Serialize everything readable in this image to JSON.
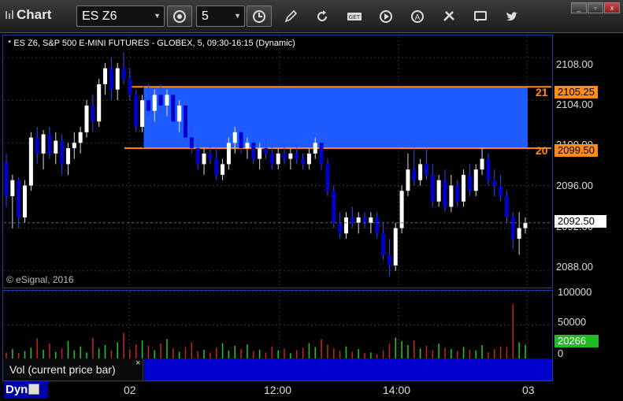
{
  "toolbar": {
    "title": "Chart",
    "symbol": "ES Z6",
    "interval": "5",
    "icons": [
      "settings-icon",
      "clock-icon",
      "pencil-icon",
      "refresh-icon",
      "get-icon",
      "play-icon",
      "alert-icon",
      "tools-icon",
      "comment-icon",
      "twitter-icon"
    ]
  },
  "window": {
    "controls": [
      "minimize",
      "restore",
      "close"
    ]
  },
  "chart": {
    "title": "* ES Z6, S&P 500 E-MINI FUTURES - GLOBEX, 5, 09:30-16:15 (Dynamic)",
    "watermark": "© eSignal, 2016",
    "price_labels": [
      "2108.00",
      "2104.00",
      "2100.00",
      "2096.00",
      "2092.00",
      "2088.00"
    ],
    "zone_top_tag": "2105.25",
    "zone_bottom_tag": "2099.50",
    "zone_top_label": "21",
    "zone_bottom_label": "20",
    "last_price_tag": "2092.50",
    "colors": {
      "zone": "#1e5cff",
      "zone_line": "#ff8c1a",
      "up": "#ffffff",
      "down": "#0000cc",
      "background": "#000000"
    }
  },
  "volume": {
    "legend": "Vol (current price bar)",
    "close_glyph": "×",
    "labels": [
      "100000",
      "50000",
      "0"
    ],
    "current_tag": "20266"
  },
  "time_axis": {
    "labels": [
      "02",
      "12:00",
      "14:00",
      "03"
    ],
    "mode": "Dyn"
  },
  "chart_data": {
    "type": "candlestick",
    "ylim": [
      2086.5,
      2110.0
    ],
    "zone": {
      "low": 2099.5,
      "high": 2105.25
    },
    "last_price": 2092.5,
    "ohlc": [
      [
        2098.2,
        2099.0,
        2094.0,
        2095.0
      ],
      [
        2095.0,
        2097.0,
        2092.0,
        2096.5
      ],
      [
        2096.5,
        2096.8,
        2092.0,
        2093.0
      ],
      [
        2093.0,
        2096.5,
        2092.5,
        2096.0
      ],
      [
        2096.0,
        2101.0,
        2095.5,
        2100.5
      ],
      [
        2100.5,
        2101.5,
        2098.0,
        2099.0
      ],
      [
        2099.0,
        2101.2,
        2097.5,
        2100.8
      ],
      [
        2100.8,
        2101.5,
        2098.5,
        2099.0
      ],
      [
        2099.0,
        2101.0,
        2098.0,
        2100.2
      ],
      [
        2100.2,
        2100.8,
        2097.0,
        2098.0
      ],
      [
        2098.0,
        2100.0,
        2097.0,
        2099.5
      ],
      [
        2099.5,
        2101.0,
        2098.5,
        2100.0
      ],
      [
        2100.0,
        2101.5,
        2099.0,
        2101.0
      ],
      [
        2101.0,
        2104.0,
        2100.5,
        2103.5
      ],
      [
        2103.5,
        2104.5,
        2101.0,
        2102.0
      ],
      [
        2102.0,
        2106.0,
        2101.5,
        2105.5
      ],
      [
        2105.5,
        2107.5,
        2104.5,
        2107.0
      ],
      [
        2107.0,
        2108.0,
        2104.0,
        2105.0
      ],
      [
        2105.0,
        2107.5,
        2104.0,
        2107.0
      ],
      [
        2107.0,
        2108.5,
        2105.5,
        2106.0
      ],
      [
        2106.0,
        2107.0,
        2104.0,
        2104.5
      ],
      [
        2104.5,
        2105.0,
        2101.0,
        2101.5
      ],
      [
        2101.5,
        2104.5,
        2101.0,
        2104.0
      ],
      [
        2104.0,
        2105.5,
        2102.5,
        2103.0
      ],
      [
        2103.0,
        2105.0,
        2102.0,
        2104.5
      ],
      [
        2104.5,
        2105.5,
        2103.0,
        2103.5
      ],
      [
        2103.5,
        2105.0,
        2102.5,
        2104.5
      ],
      [
        2104.5,
        2105.0,
        2101.5,
        2102.0
      ],
      [
        2102.0,
        2104.0,
        2101.0,
        2103.5
      ],
      [
        2103.5,
        2104.0,
        2100.0,
        2100.5
      ],
      [
        2100.5,
        2101.5,
        2099.0,
        2099.5
      ],
      [
        2099.5,
        2100.5,
        2097.5,
        2098.0
      ],
      [
        2098.0,
        2099.5,
        2097.0,
        2099.0
      ],
      [
        2099.0,
        2100.0,
        2098.0,
        2098.5
      ],
      [
        2098.5,
        2099.5,
        2096.5,
        2097.0
      ],
      [
        2097.0,
        2098.5,
        2096.5,
        2098.0
      ],
      [
        2098.0,
        2100.5,
        2097.5,
        2100.0
      ],
      [
        2100.0,
        2101.5,
        2099.0,
        2101.0
      ],
      [
        2101.0,
        2101.5,
        2099.0,
        2099.5
      ],
      [
        2099.5,
        2100.5,
        2098.5,
        2100.0
      ],
      [
        2100.0,
        2100.5,
        2098.0,
        2098.5
      ],
      [
        2098.5,
        2100.0,
        2097.5,
        2099.5
      ],
      [
        2099.5,
        2100.5,
        2098.5,
        2099.0
      ],
      [
        2099.0,
        2100.0,
        2097.5,
        2098.0
      ],
      [
        2098.0,
        2099.5,
        2097.5,
        2099.0
      ],
      [
        2099.0,
        2100.0,
        2098.0,
        2098.5
      ],
      [
        2098.5,
        2099.5,
        2097.5,
        2099.0
      ],
      [
        2099.0,
        2100.0,
        2098.0,
        2098.5
      ],
      [
        2098.5,
        2099.0,
        2097.5,
        2098.0
      ],
      [
        2098.0,
        2099.5,
        2097.5,
        2099.0
      ],
      [
        2099.0,
        2100.5,
        2098.5,
        2100.0
      ],
      [
        2100.0,
        2100.5,
        2097.5,
        2098.0
      ],
      [
        2098.0,
        2098.5,
        2095.0,
        2095.5
      ],
      [
        2095.5,
        2096.0,
        2092.0,
        2092.5
      ],
      [
        2092.5,
        2093.5,
        2091.0,
        2091.5
      ],
      [
        2091.5,
        2093.5,
        2091.0,
        2093.0
      ],
      [
        2093.0,
        2094.0,
        2092.0,
        2092.5
      ],
      [
        2092.5,
        2093.5,
        2091.5,
        2093.0
      ],
      [
        2093.0,
        2093.5,
        2092.0,
        2092.5
      ],
      [
        2092.5,
        2093.5,
        2091.5,
        2093.0
      ],
      [
        2093.0,
        2093.5,
        2091.0,
        2091.5
      ],
      [
        2091.5,
        2092.5,
        2089.0,
        2089.5
      ],
      [
        2089.5,
        2091.0,
        2087.5,
        2088.5
      ],
      [
        2088.5,
        2092.5,
        2088.0,
        2092.0
      ],
      [
        2092.0,
        2096.0,
        2091.5,
        2095.5
      ],
      [
        2095.5,
        2099.0,
        2095.0,
        2097.5
      ],
      [
        2097.5,
        2099.5,
        2096.0,
        2096.5
      ],
      [
        2096.5,
        2098.5,
        2096.0,
        2098.0
      ],
      [
        2098.0,
        2099.5,
        2096.5,
        2097.0
      ],
      [
        2097.0,
        2098.0,
        2094.0,
        2094.5
      ],
      [
        2094.5,
        2097.0,
        2094.0,
        2096.5
      ],
      [
        2096.5,
        2097.5,
        2093.5,
        2094.0
      ],
      [
        2094.0,
        2097.0,
        2093.5,
        2096.0
      ],
      [
        2096.0,
        2096.5,
        2094.0,
        2094.5
      ],
      [
        2094.5,
        2097.5,
        2094.0,
        2097.0
      ],
      [
        2097.0,
        2098.0,
        2095.0,
        2095.5
      ],
      [
        2095.5,
        2098.0,
        2095.0,
        2097.5
      ],
      [
        2097.5,
        2099.5,
        2097.0,
        2098.5
      ],
      [
        2098.5,
        2099.0,
        2096.0,
        2096.5
      ],
      [
        2096.5,
        2097.5,
        2095.0,
        2096.0
      ],
      [
        2096.0,
        2097.0,
        2094.5,
        2095.0
      ],
      [
        2095.0,
        2095.5,
        2092.5,
        2093.0
      ],
      [
        2093.0,
        2093.5,
        2090.0,
        2091.0
      ],
      [
        2091.0,
        2093.5,
        2089.5,
        2092.0
      ],
      [
        2092.0,
        2093.0,
        2091.5,
        2092.5
      ]
    ],
    "volume": [
      9000,
      14000,
      8000,
      11000,
      16000,
      30000,
      13000,
      22000,
      10000,
      15000,
      26000,
      12000,
      18000,
      9000,
      31000,
      15000,
      20000,
      12000,
      24000,
      38000,
      14000,
      21000,
      27000,
      19000,
      12000,
      22000,
      29000,
      15000,
      10000,
      17000,
      24000,
      11000,
      13000,
      9000,
      16000,
      23000,
      12000,
      19000,
      14000,
      21000,
      11000,
      13000,
      9000,
      18000,
      12000,
      15000,
      8000,
      12000,
      16000,
      23000,
      17000,
      29000,
      21000,
      15000,
      12000,
      18000,
      10000,
      14000,
      8000,
      9000,
      6000,
      12000,
      22000,
      31000,
      26000,
      20000,
      27000,
      15000,
      19000,
      12000,
      22000,
      16000,
      14000,
      11000,
      17000,
      13000,
      12000,
      20000,
      9000,
      14000,
      18000,
      17000,
      81000,
      24000,
      20266
    ]
  }
}
